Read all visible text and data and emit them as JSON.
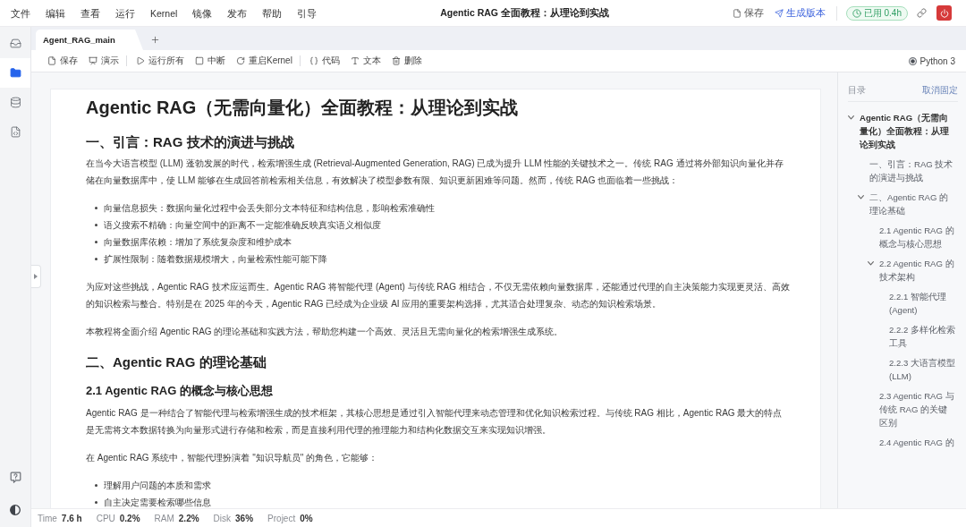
{
  "menu_bar": {
    "menus": [
      "文件",
      "编辑",
      "查看",
      "运行",
      "Kernel",
      "镜像",
      "发布",
      "帮助",
      "引导"
    ],
    "title": "Agentic RAG 全面教程：从理论到实战",
    "actions": [
      {
        "kind": "save",
        "label": "保存"
      },
      {
        "kind": "publish",
        "label": "生成版本"
      }
    ],
    "usage": "已用 0.4h"
  },
  "sidebar": {
    "items": [
      {
        "kind": "inbox",
        "selected": false
      },
      {
        "kind": "files",
        "selected": true
      },
      {
        "kind": "database",
        "selected": false
      },
      {
        "kind": "code",
        "selected": false
      }
    ]
  },
  "tabs": [
    {
      "label": "Agent_RAG_main",
      "selected": true
    }
  ],
  "toolbar": {
    "groups": [
      [
        {
          "kind": "save",
          "label": "保存"
        },
        {
          "kind": "present",
          "label": "演示"
        }
      ],
      [
        {
          "kind": "run_all",
          "label": "运行所有"
        },
        {
          "kind": "interrupt",
          "label": "中断"
        },
        {
          "kind": "restart",
          "label": "重启Kernel"
        }
      ],
      [
        {
          "kind": "code",
          "label": "代码"
        },
        {
          "kind": "text",
          "label": "文本"
        },
        {
          "kind": "delete",
          "label": "删除"
        }
      ]
    ],
    "kernel": "Python 3"
  },
  "document": {
    "blocks": [
      {
        "kind": "title",
        "text": "Agentic RAG（无需向量化）全面教程：从理论到实战"
      },
      {
        "kind": "heading",
        "text": "一、引言：RAG 技术的演进与挑战"
      },
      {
        "kind": "paragraph",
        "text": "在当今大语言模型 (LLM) 蓬勃发展的时代，检索增强生成 (Retrieval-Augmented Generation, RAG) 已成为提升 LLM 性能的关键技术之一。传统 RAG 通过将外部知识向量化并存储在向量数据库中，使 LLM 能够在生成回答前检索相关信息，有效解决了模型参数有限、知识更新困难等问题。然而，传统 RAG 也面临着一些挑战："
      },
      {
        "kind": "list",
        "items": [
          "向量信息损失：数据向量化过程中会丢失部分文本特征和结构信息，影响检索准确性",
          "语义搜索不精确：向量空间中的距离不一定能准确反映真实语义相似度",
          "向量数据库依赖：增加了系统复杂度和维护成本",
          "扩展性限制：随着数据规模增大，向量检索性能可能下降"
        ]
      },
      {
        "kind": "paragraph",
        "text": "为应对这些挑战，Agentic RAG 技术应运而生。Agentic RAG 将智能代理 (Agent) 与传统 RAG 相结合，不仅无需依赖向量数据库，还能通过代理的自主决策能力实现更灵活、高效的知识检索与整合。特别是在 2025 年的今天，Agentic RAG 已经成为企业级 AI 应用的重要架构选择，尤其适合处理复杂、动态的知识检索场景。"
      },
      {
        "kind": "paragraph",
        "text": "本教程将全面介绍 Agentic RAG 的理论基础和实践方法，帮助您构建一个高效、灵活且无需向量化的检索增强生成系统。"
      },
      {
        "kind": "heading",
        "text": "二、Agentic RAG 的理论基础"
      },
      {
        "kind": "subheading",
        "text": "2.1 Agentic RAG 的概念与核心思想"
      },
      {
        "kind": "paragraph",
        "text": "Agentic RAG 是一种结合了智能代理与检索增强生成的技术框架，其核心思想是通过引入智能代理来动态管理和优化知识检索过程。与传统 RAG 相比，Agentic RAG 最大的特点是无需将文本数据转换为向量形式进行存储和检索，而是直接利用代理的推理能力和结构化数据交互来实现知识增强。"
      },
      {
        "kind": "paragraph",
        "text": "在 Agentic RAG 系统中，智能代理扮演着 \"知识导航员\" 的角色，它能够："
      },
      {
        "kind": "list",
        "items": [
          "理解用户问题的本质和需求",
          "自主决定需要检索哪些信息"
        ]
      }
    ]
  },
  "toc": {
    "title": "目录",
    "unpin": "取消固定",
    "items": [
      {
        "label": "Agentic RAG（无需向量化）全面教程：从理论到实战",
        "expanded": true,
        "children": [
          {
            "label": "一、引言：RAG 技术的演进与挑战",
            "expanded": false
          },
          {
            "label": "二、Agentic RAG 的理论基础",
            "expanded": true,
            "children": [
              {
                "label": "2.1 Agentic RAG 的概念与核心思想",
                "expanded": false
              },
              {
                "label": "2.2 Agentic RAG 的技术架构",
                "expanded": true,
                "children": [
                  {
                    "label": "2.2.1 智能代理 (Agent)",
                    "expanded": false
                  },
                  {
                    "label": "2.2.2 多样化检索工具",
                    "expanded": false
                  },
                  {
                    "label": "2.2.3 大语言模型 (LLM)",
                    "expanded": false
                  }
                ]
              },
              {
                "label": "2.3 Agentic RAG 与传统 RAG 的关键区别",
                "expanded": false
              },
              {
                "label": "2.4 Agentic RAG 的",
                "expanded": false
              }
            ]
          }
        ]
      }
    ]
  },
  "status_bar": [
    {
      "label": "Time",
      "value": "7.6 h"
    },
    {
      "label": "CPU",
      "value": "0.2%"
    },
    {
      "label": "RAM",
      "value": "2.2%"
    },
    {
      "label": "Disk",
      "value": "36%"
    },
    {
      "label": "Project",
      "value": "0%"
    }
  ]
}
